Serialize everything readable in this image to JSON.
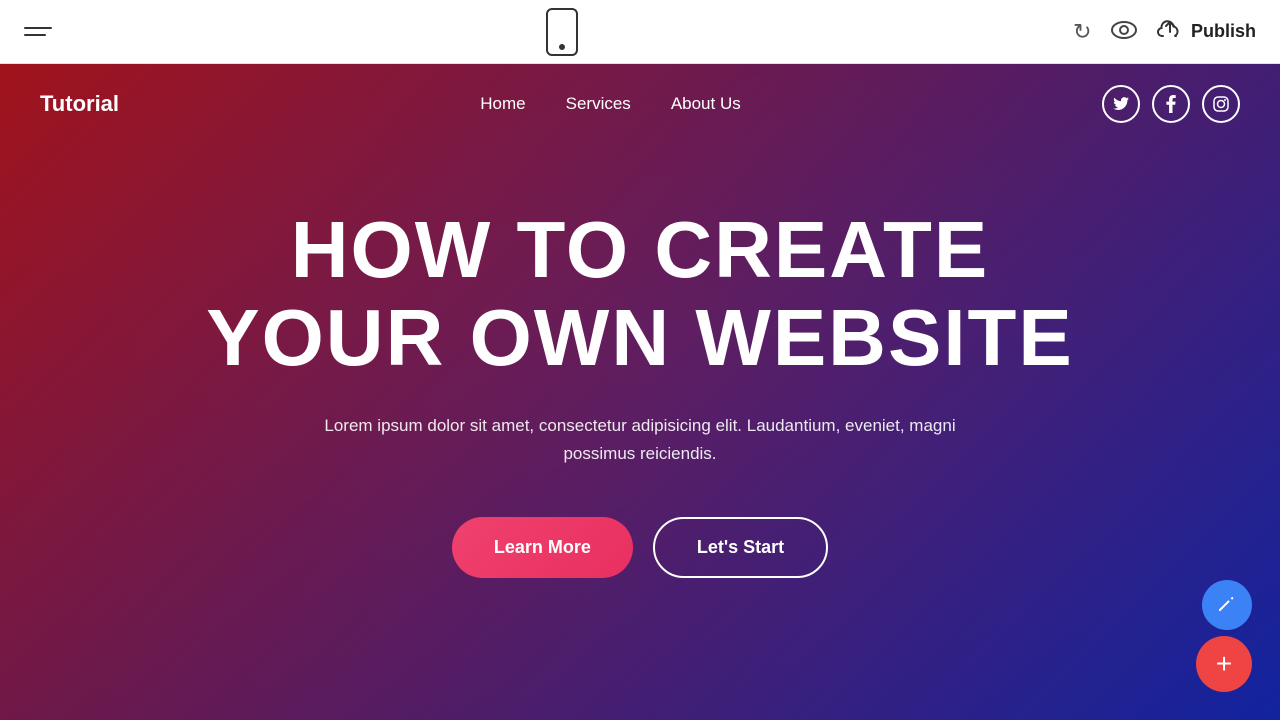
{
  "toolbar": {
    "undo_icon": "↺",
    "eye_icon": "👁",
    "cloud_icon": "☁",
    "publish_label": "Publish"
  },
  "site": {
    "logo": "Tutorial",
    "nav": {
      "items": [
        {
          "label": "Home"
        },
        {
          "label": "Services"
        },
        {
          "label": "About Us"
        }
      ]
    },
    "social": [
      {
        "icon": "𝕋",
        "name": "twitter"
      },
      {
        "icon": "f",
        "name": "facebook"
      },
      {
        "icon": "📷",
        "name": "instagram"
      }
    ]
  },
  "hero": {
    "title_line1": "HOW TO CREATE",
    "title_line2": "YOUR OWN WEBSITE",
    "subtitle": "Lorem ipsum dolor sit amet, consectetur adipisicing elit. Laudantium, eveniet, magni possimus reiciendis.",
    "btn_learn_more": "Learn More",
    "btn_lets_start": "Let's Start"
  },
  "fabs": {
    "pencil_icon": "✏",
    "add_icon": "+"
  }
}
